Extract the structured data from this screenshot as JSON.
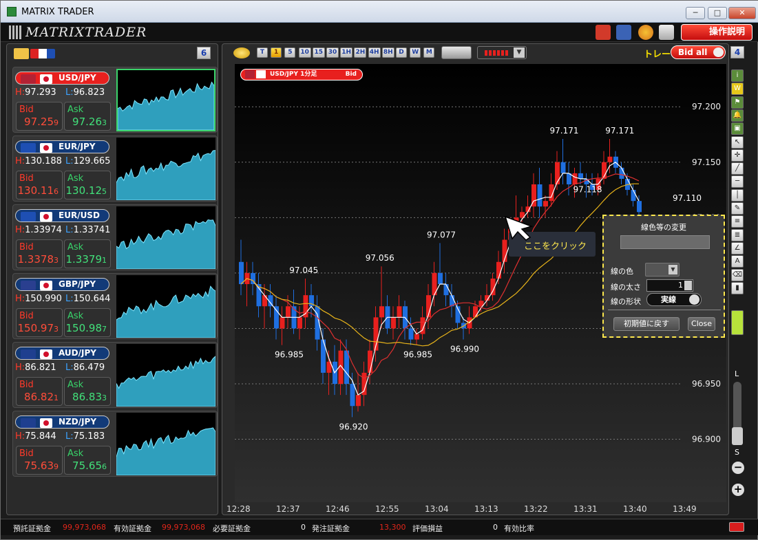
{
  "window": {
    "title": "MATRIX TRADER",
    "minimize": "─",
    "maximize": "□",
    "close": "✕"
  },
  "header": {
    "logo": "MATRIXTRADER",
    "manual_button": "操作説明"
  },
  "left_panel": {
    "count_badge": "6"
  },
  "pairs": [
    {
      "name": "USD/JPY",
      "high": "97.293",
      "low": "96.823",
      "bid_label": "Bid",
      "bid_main": "97.25",
      "bid_pip": "9",
      "ask_label": "Ask",
      "ask_main": "97.26",
      "ask_pip": "3",
      "selected": true,
      "flag1": "#b22234",
      "flag2": "jp"
    },
    {
      "name": "EUR/JPY",
      "high": "130.188",
      "low": "129.665",
      "bid_label": "Bid",
      "bid_main": "130.11",
      "bid_pip": "6",
      "ask_label": "Ask",
      "ask_main": "130.12",
      "ask_pip": "5",
      "selected": false,
      "flag1": "#1e4fb3",
      "flag2": "jp"
    },
    {
      "name": "EUR/USD",
      "high": "1.33974",
      "low": "1.33741",
      "bid_label": "Bid",
      "bid_main": "1.3378",
      "bid_pip": "3",
      "ask_label": "Ask",
      "ask_main": "1.3379",
      "ask_pip": "1",
      "selected": false,
      "flag1": "#1e4fb3",
      "flag2": "us"
    },
    {
      "name": "GBP/JPY",
      "high": "150.990",
      "low": "150.644",
      "bid_label": "Bid",
      "bid_main": "150.97",
      "bid_pip": "3",
      "ask_label": "Ask",
      "ask_main": "150.98",
      "ask_pip": "7",
      "selected": false,
      "flag1": "#2a3f8f",
      "flag2": "jp"
    },
    {
      "name": "AUD/JPY",
      "high": "86.821",
      "low": "86.479",
      "bid_label": "Bid",
      "bid_main": "86.82",
      "bid_pip": "1",
      "ask_label": "Ask",
      "ask_main": "86.83",
      "ask_pip": "3",
      "selected": false,
      "flag1": "#1f3f8f",
      "flag2": "jp"
    },
    {
      "name": "NZD/JPY",
      "high": "75.844",
      "low": "75.183",
      "bid_label": "Bid",
      "bid_main": "75.63",
      "bid_pip": "9",
      "ask_label": "Ask",
      "ask_main": "75.65",
      "ask_pip": "6",
      "selected": false,
      "flag1": "#1f3f8f",
      "flag2": "jp"
    }
  ],
  "toolbar": {
    "timeframes": [
      "T",
      "1",
      "5",
      "10",
      "15",
      "30",
      "1H",
      "2H",
      "4H",
      "8H",
      "D",
      "W",
      "M"
    ],
    "active_timeframe": "1",
    "trade_label": "トレード",
    "bid_all": "Bid all",
    "count_badge": "4"
  },
  "chart_header": {
    "symbol": "USD/JPY 1分足",
    "side": "Bid"
  },
  "chart_data": {
    "type": "candlestick",
    "y_ticks": [
      "97.200",
      "97.150",
      "97.100",
      "97.050",
      "97.000",
      "96.950",
      "96.900"
    ],
    "y_tick_values": [
      97.2,
      97.15,
      97.1,
      97.05,
      97.0,
      96.95,
      96.9
    ],
    "ylim": [
      96.86,
      97.22
    ],
    "x_ticks": [
      "12:28",
      "12:37",
      "12:46",
      "12:55",
      "13:04",
      "13:13",
      "13:22",
      "13:31",
      "13:40",
      "13:49"
    ],
    "annotations": [
      {
        "text": "97.045",
        "x": 10.5,
        "y": 97.045
      },
      {
        "text": "96.985",
        "x": 8,
        "y": 96.985
      },
      {
        "text": "96.920",
        "x": 19,
        "y": 96.92
      },
      {
        "text": "97.056",
        "x": 23.5,
        "y": 97.056
      },
      {
        "text": "96.985",
        "x": 30,
        "y": 96.985
      },
      {
        "text": "97.077",
        "x": 34,
        "y": 97.077
      },
      {
        "text": "96.990",
        "x": 38,
        "y": 96.99
      },
      {
        "text": "97.171",
        "x": 55,
        "y": 97.171
      },
      {
        "text": "97.171",
        "x": 64.5,
        "y": 97.171
      },
      {
        "text": "97.118",
        "x": 59,
        "y": 97.118
      },
      {
        "text": "97.110",
        "x": 76,
        "y": 97.11
      }
    ],
    "candles": [
      [
        97.06,
        97.08,
        97.03,
        97.04
      ],
      [
        97.04,
        97.06,
        97.02,
        97.05
      ],
      [
        97.05,
        97.06,
        97.03,
        97.04
      ],
      [
        97.04,
        97.05,
        97.01,
        97.02
      ],
      [
        97.02,
        97.04,
        97.0,
        97.03
      ],
      [
        97.03,
        97.04,
        97.01,
        97.02
      ],
      [
        97.02,
        97.03,
        96.99,
        97.0
      ],
      [
        97.0,
        97.02,
        96.985,
        97.01
      ],
      [
        97.01,
        97.03,
        97.0,
        97.02
      ],
      [
        97.02,
        97.035,
        96.995,
        97.0
      ],
      [
        97.0,
        97.02,
        96.99,
        97.01
      ],
      [
        97.01,
        97.045,
        97.0,
        97.03
      ],
      [
        97.03,
        97.04,
        97.01,
        97.02
      ],
      [
        97.02,
        97.03,
        96.98,
        96.99
      ],
      [
        96.99,
        97.0,
        96.95,
        96.96
      ],
      [
        96.96,
        96.98,
        96.94,
        96.97
      ],
      [
        96.97,
        96.985,
        96.94,
        96.95
      ],
      [
        96.95,
        96.99,
        96.94,
        96.98
      ],
      [
        96.98,
        96.99,
        96.94,
        96.95
      ],
      [
        96.95,
        96.96,
        96.92,
        96.93
      ],
      [
        96.93,
        96.96,
        96.925,
        96.94
      ],
      [
        96.94,
        96.97,
        96.93,
        96.96
      ],
      [
        96.96,
        96.99,
        96.95,
        96.98
      ],
      [
        96.98,
        97.02,
        96.97,
        97.01
      ],
      [
        97.01,
        97.056,
        97.0,
        97.02
      ],
      [
        97.02,
        97.03,
        96.995,
        97.0
      ],
      [
        97.0,
        97.02,
        96.99,
        97.01
      ],
      [
        97.01,
        97.03,
        97.0,
        97.02
      ],
      [
        97.02,
        97.025,
        96.99,
        97.0
      ],
      [
        97.0,
        97.01,
        96.985,
        96.99
      ],
      [
        96.99,
        97.0,
        96.985,
        96.995
      ],
      [
        96.995,
        97.02,
        96.99,
        97.01
      ],
      [
        97.01,
        97.04,
        97.0,
        97.03
      ],
      [
        97.03,
        97.06,
        97.02,
        97.05
      ],
      [
        97.05,
        97.077,
        97.04,
        97.04
      ],
      [
        97.04,
        97.05,
        97.02,
        97.03
      ],
      [
        97.03,
        97.04,
        97.01,
        97.02
      ],
      [
        97.02,
        97.025,
        97.0,
        97.005
      ],
      [
        97.005,
        97.01,
        96.99,
        97.0
      ],
      [
        97.0,
        97.02,
        96.995,
        97.01
      ],
      [
        97.01,
        97.025,
        97.01,
        97.02
      ],
      [
        97.02,
        97.03,
        97.015,
        97.025
      ],
      [
        97.025,
        97.04,
        97.02,
        97.03
      ],
      [
        97.03,
        97.05,
        97.025,
        97.045
      ],
      [
        97.045,
        97.07,
        97.04,
        97.06
      ],
      [
        97.06,
        97.09,
        97.05,
        97.08
      ],
      [
        97.08,
        97.1,
        97.07,
        97.09
      ],
      [
        97.09,
        97.12,
        97.08,
        97.1
      ],
      [
        97.1,
        97.11,
        97.095,
        97.105
      ],
      [
        97.105,
        97.12,
        97.1,
        97.11
      ],
      [
        97.11,
        97.14,
        97.1,
        97.13
      ],
      [
        97.13,
        97.145,
        97.1,
        97.11
      ],
      [
        97.11,
        97.12,
        97.1,
        97.115
      ],
      [
        97.115,
        97.14,
        97.11,
        97.13
      ],
      [
        97.13,
        97.16,
        97.125,
        97.15
      ],
      [
        97.15,
        97.171,
        97.13,
        97.14
      ],
      [
        97.14,
        97.15,
        97.12,
        97.13
      ],
      [
        97.13,
        97.145,
        97.118,
        97.14
      ],
      [
        97.14,
        97.15,
        97.13,
        97.135
      ],
      [
        97.135,
        97.14,
        97.118,
        97.13
      ],
      [
        97.13,
        97.14,
        97.12,
        97.125
      ],
      [
        97.125,
        97.14,
        97.12,
        97.135
      ],
      [
        97.135,
        97.16,
        97.13,
        97.15
      ],
      [
        97.15,
        97.171,
        97.14,
        97.155
      ],
      [
        97.155,
        97.16,
        97.14,
        97.145
      ],
      [
        97.145,
        97.15,
        97.13,
        97.135
      ],
      [
        97.135,
        97.14,
        97.12,
        97.125
      ],
      [
        97.125,
        97.13,
        97.11,
        97.115
      ],
      [
        97.115,
        97.12,
        97.1,
        97.105
      ]
    ]
  },
  "click_hint": "ここをクリック",
  "dialog": {
    "title": "線色等の変更",
    "color_label": "線の色",
    "width_label": "線の太さ",
    "width_value": "1",
    "style_label": "線の形状",
    "style_value": "実線",
    "reset_button": "初期値に戻す",
    "close_button": "Close"
  },
  "zoom": {
    "large": "L",
    "small": "S"
  },
  "status": {
    "deposit_label": "預託証拠金",
    "deposit_value": "99,973,068",
    "effective_label": "有効証拠金",
    "effective_value": "99,973,068",
    "required_label": "必要証拠金",
    "required_value": "0",
    "order_label": "発注証拠金",
    "order_value": "13,300",
    "pl_label": "評価損益",
    "pl_value": "0",
    "ratio_label": "有効比率"
  },
  "colors": {
    "up": "#e8201e",
    "down": "#1f6fe0",
    "ma_fast": "#ffffff",
    "ma_mid": "#e03030",
    "ma_slow": "#e8b41a"
  }
}
